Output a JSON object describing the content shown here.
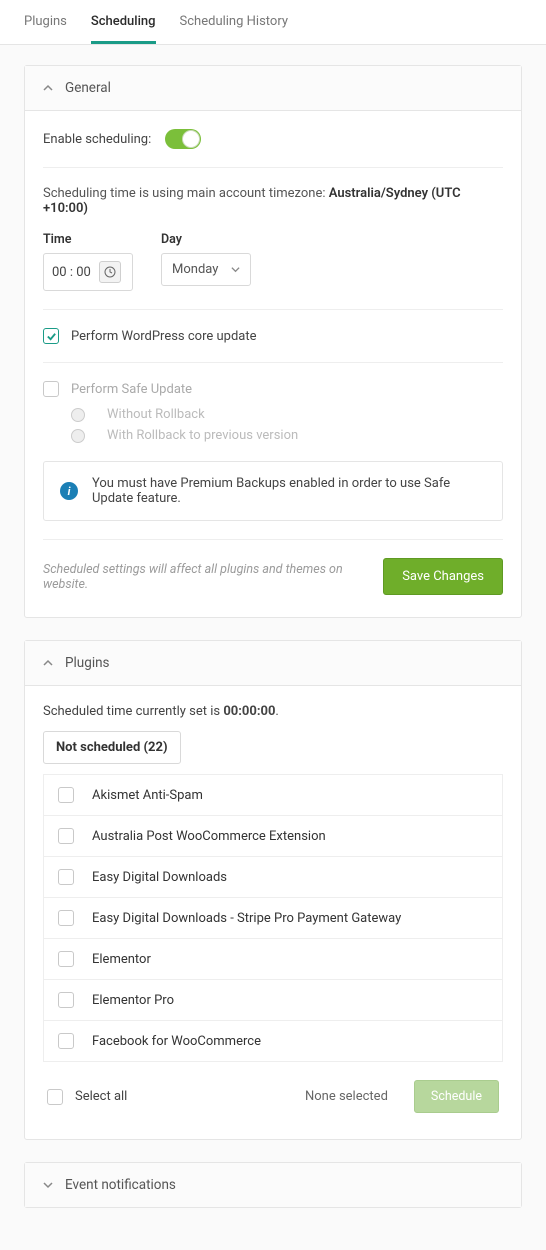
{
  "tabs": {
    "plugins": "Plugins",
    "scheduling": "Scheduling",
    "history": "Scheduling History"
  },
  "general": {
    "title": "General",
    "enable_label": "Enable scheduling:",
    "tz_prefix": "Scheduling time is using main account timezone: ",
    "tz_value": "Australia/Sydney (UTC +10:00)",
    "time_label": "Time",
    "time_value": "00 : 00",
    "day_label": "Day",
    "day_value": "Monday",
    "core_update": "Perform WordPress core update",
    "safe_update": "Perform Safe Update",
    "opt_without": "Without Rollback",
    "opt_with": "With Rollback to previous version",
    "info_text": "You must have Premium Backups enabled in order to use Safe Update feature.",
    "note": "Scheduled settings will affect all plugins and themes on website.",
    "save": "Save Changes"
  },
  "plugins": {
    "title": "Plugins",
    "time_prefix": "Scheduled time currently set is ",
    "time_value": "00:00:00",
    "pill_prefix": "Not scheduled ",
    "pill_count": "(22)",
    "items": [
      "Akismet Anti-Spam",
      "Australia Post WooCommerce Extension",
      "Easy Digital Downloads",
      "Easy Digital Downloads - Stripe Pro Payment Gateway",
      "Elementor",
      "Elementor Pro",
      "Facebook for WooCommerce"
    ],
    "select_all": "Select all",
    "none_selected": "None selected",
    "schedule_btn": "Schedule"
  },
  "events": {
    "title": "Event notifications"
  }
}
